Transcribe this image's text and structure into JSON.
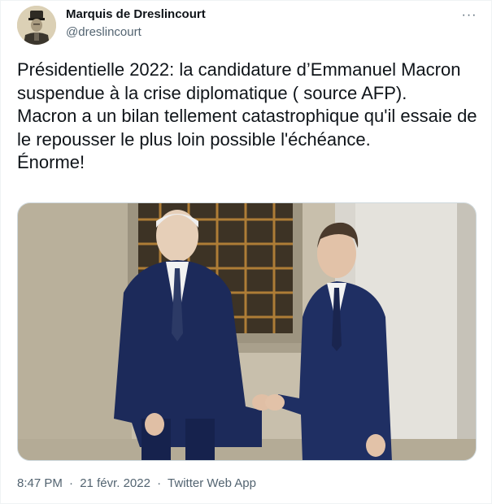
{
  "tweet": {
    "author": {
      "display_name": "Marquis de Dreslincourt",
      "handle": "@dreslincourt"
    },
    "more_icon": "more-horizontal-icon",
    "more_label": "···",
    "text": "Présidentielle 2022: la candidature d’Emmanuel Macron suspendue à la crise diplomatique ( source AFP).\nMacron a un bilan tellement catastrophique qu'il essaie de le repousser le plus loin possible l'échéance.\nÉnorme!",
    "meta": {
      "time": "8:47 PM",
      "date": "21 févr. 2022",
      "separator": "·",
      "source": "Twitter Web App"
    }
  },
  "colors": {
    "text_primary": "#0f1419",
    "text_secondary": "#536471",
    "border": "#cfd9de",
    "suit_navy": "#1c2a5a",
    "wall": "#c9c1ae"
  }
}
